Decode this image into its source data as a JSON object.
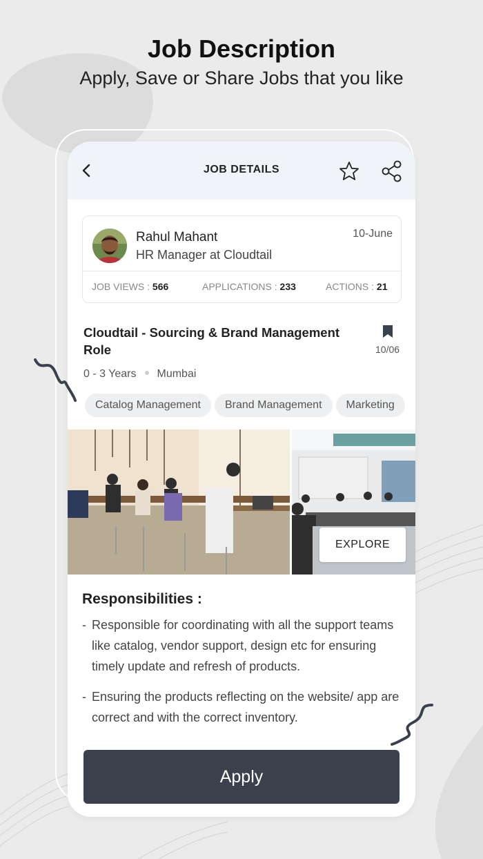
{
  "promo": {
    "title": "Job Description",
    "subtitle": "Apply, Save or Share Jobs that you like"
  },
  "header": {
    "title": "JOB DETAILS",
    "icons": [
      "back-arrow-icon",
      "star-icon",
      "share-icon"
    ]
  },
  "recruiter": {
    "name": "Rahul Mahant",
    "role": "HR Manager at Cloudtail",
    "date": "10-June",
    "stats": [
      {
        "label": "JOB VIEWS : ",
        "value": "566"
      },
      {
        "label": "APPLICATIONS : ",
        "value": "233"
      },
      {
        "label": "ACTIONS : ",
        "value": "21"
      }
    ]
  },
  "job": {
    "title": "Cloudtail - Sourcing & Brand Management Role",
    "post_date": "10/06",
    "experience": "0 - 3 Years",
    "location": "Mumbai",
    "tags": [
      "Catalog Management",
      "Brand Management",
      "Marketing"
    ]
  },
  "gallery": {
    "explore_label": "EXPLORE"
  },
  "responsibilities": {
    "heading": "Responsibilities :",
    "items": [
      "Responsible for coordinating with all the support teams like catalog, vendor support, design etc for ensuring timely update and refresh of products.",
      "Ensuring the products reflecting on the website/ app are correct and with the correct inventory."
    ]
  },
  "footer": {
    "apply_label": "Apply"
  },
  "colors": {
    "background": "#ebebeb",
    "header_bg": "#f0f3f7",
    "apply_button": "#3b404d",
    "tag_bg": "#eeeff1"
  }
}
